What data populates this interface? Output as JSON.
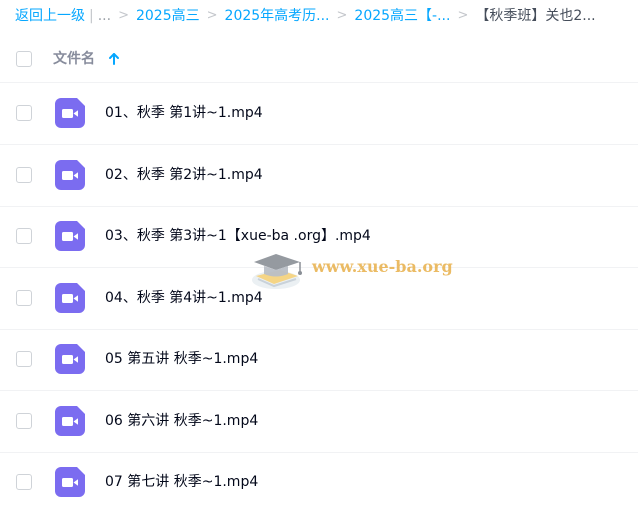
{
  "breadcrumb": {
    "back": "返回上一级",
    "ellipsis": "...",
    "items": [
      "2025高三",
      "2025年高考历...",
      "2025高三【-..."
    ],
    "current": "【秋季班】关也2..."
  },
  "header": {
    "column_name": "文件名"
  },
  "files": [
    {
      "name": "01、秋季 第1讲~1.mp4"
    },
    {
      "name": "02、秋季 第2讲~1.mp4"
    },
    {
      "name": "03、秋季 第3讲~1【xue-ba .org】.mp4"
    },
    {
      "name": "04、秋季 第4讲~1.mp4"
    },
    {
      "name": "05 第五讲 秋季~1.mp4"
    },
    {
      "name": "06 第六讲 秋季~1.mp4"
    },
    {
      "name": "07 第七讲 秋季~1.mp4"
    }
  ],
  "watermark": {
    "text": "www.xue-ba.org"
  },
  "colors": {
    "link": "#06a7ff",
    "video_icon": "#7b6cf0"
  }
}
